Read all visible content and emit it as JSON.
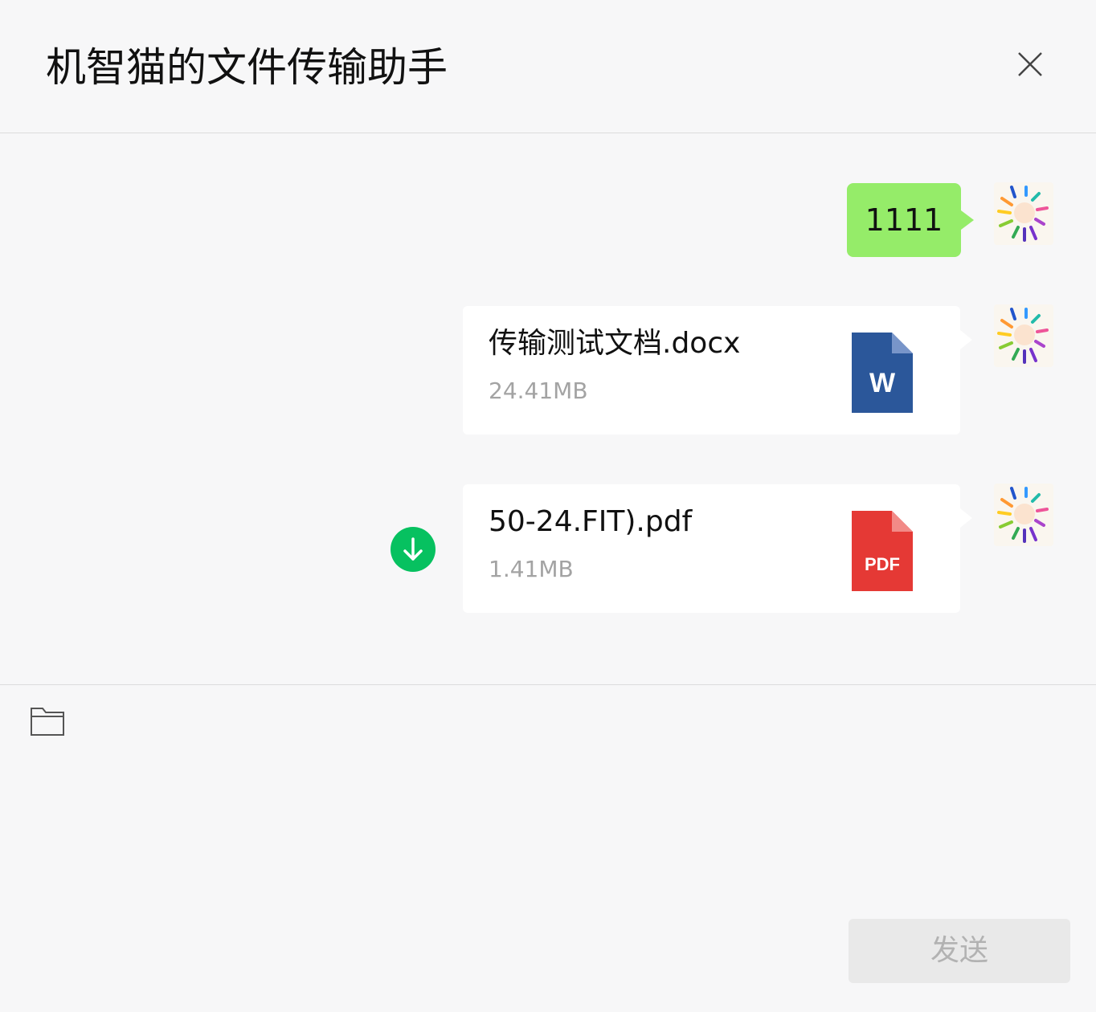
{
  "window": {
    "title": "机智猫的文件传输助手",
    "close_icon": "close-icon"
  },
  "messages": [
    {
      "type": "text",
      "text": "1111",
      "bubble_color": "#95ec69"
    },
    {
      "type": "file",
      "file_name": "传输测试文档.docx",
      "file_size": "24.41MB",
      "file_type": "word",
      "icon_label": "W",
      "icon_color": "#2b579a"
    },
    {
      "type": "file",
      "file_name": "50-24.FIT).pdf",
      "file_size": "1.41MB",
      "file_type": "pdf",
      "icon_label": "PDF",
      "icon_color": "#e53935",
      "download_icon": "download-icon",
      "download_color": "#07c160"
    }
  ],
  "composer": {
    "folder_icon": "folder-icon",
    "send_label": "发送"
  },
  "colors": {
    "background": "#f7f7f8",
    "divider": "#dcdcdc",
    "send_button_bg": "#e9e9e9",
    "send_button_text": "#b2b2b2"
  }
}
